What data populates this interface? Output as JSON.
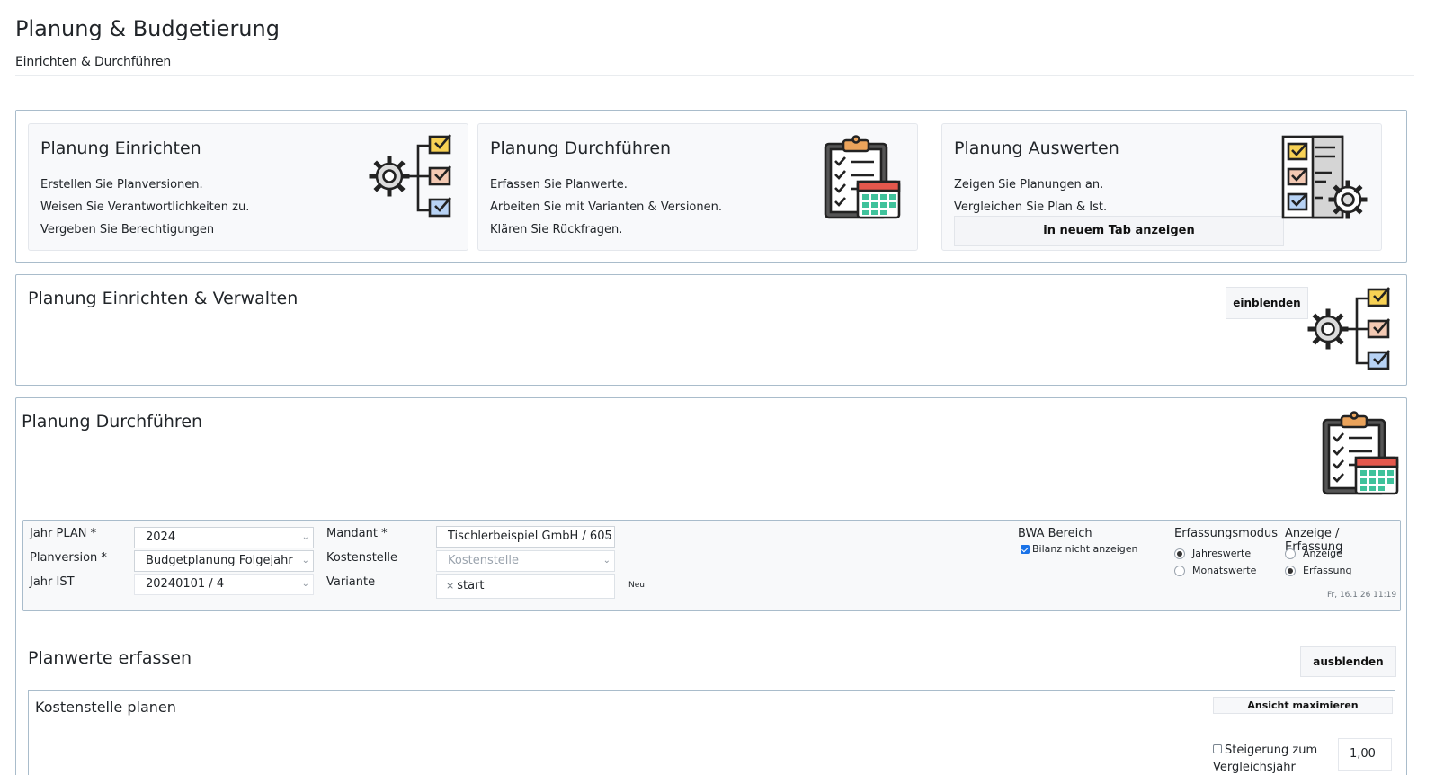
{
  "header": {
    "title": "Planung & Budgetierung",
    "subtitle": "Einrichten & Durchführen"
  },
  "cards": [
    {
      "title": "Planung Einrichten",
      "lines": [
        "Erstellen Sie Planversionen.",
        "Weisen Sie Verantwortlichkeiten zu.",
        "Vergeben Sie Berechtigungen"
      ],
      "icon": "gear-checklist-icon"
    },
    {
      "title": "Planung Durchführen",
      "lines": [
        "Erfassen Sie Planwerte.",
        "Arbeiten Sie mit Varianten & Versionen.",
        "Klären Sie Rückfragen."
      ],
      "icon": "clipboard-calendar-icon"
    },
    {
      "title": "Planung Auswerten",
      "lines": [
        "Zeigen Sie Planungen an.",
        "Vergleichen Sie Plan & Ist."
      ],
      "button": "in neuem Tab anzeigen",
      "icon": "checklist-gear-icon"
    }
  ],
  "verwalten": {
    "title": "Planung Einrichten & Verwalten",
    "button": "einblenden"
  },
  "durchfuehren": {
    "title": "Planung Durchführen",
    "filters": {
      "jahr_plan_label": "Jahr PLAN *",
      "jahr_plan_value": "2024",
      "planversion_label": "Planversion *",
      "planversion_value": "Budgetplanung Folgejahr",
      "jahr_ist_label": "Jahr IST",
      "jahr_ist_value": "20240101 / 4",
      "mandant_label": "Mandant *",
      "mandant_value": "Tischlerbeispiel GmbH / 605",
      "kostenstelle_label": "Kostenstelle",
      "kostenstelle_placeholder": "Kostenstelle",
      "variante_label": "Variante",
      "variante_tag": "start",
      "neu_label": "Neu",
      "bwa_label": "BWA Bereich",
      "bilanz_label": "Bilanz nicht anzeigen",
      "bilanz_checked": true,
      "erfassungsmodus_label": "Erfassungsmodus",
      "modus_options": [
        "Jahreswerte",
        "Monatswerte"
      ],
      "modus_selected": "Jahreswerte",
      "anzeige_label": "Anzeige / Erfassung",
      "anzeige_options": [
        "Anzeige",
        "Erfassung"
      ],
      "anzeige_selected": "Erfassung",
      "timestamp": "Fr, 16.1.26  11:19"
    },
    "planwerte": {
      "title": "Planwerte erfassen",
      "button": "ausblenden",
      "kostenstelle_title": "Kostenstelle planen",
      "maximize_button": "Ansicht maximieren",
      "steigerung_label_1": "Steigerung zum",
      "steigerung_label_2": "Vergleichsjahr",
      "steigerung_value": "1,00"
    }
  },
  "colors": {
    "panel_border": "#a9bccb",
    "card_bg": "#f8f9fb",
    "checkbox_accent": "#1a73e8",
    "icon_yellow": "#f7d154",
    "icon_peach": "#f3c9b3",
    "icon_blue": "#b7d2f4",
    "icon_calendar_green": "#3fc29b",
    "icon_calendar_red": "#e4574c",
    "icon_clip_orange": "#eaa35b"
  }
}
